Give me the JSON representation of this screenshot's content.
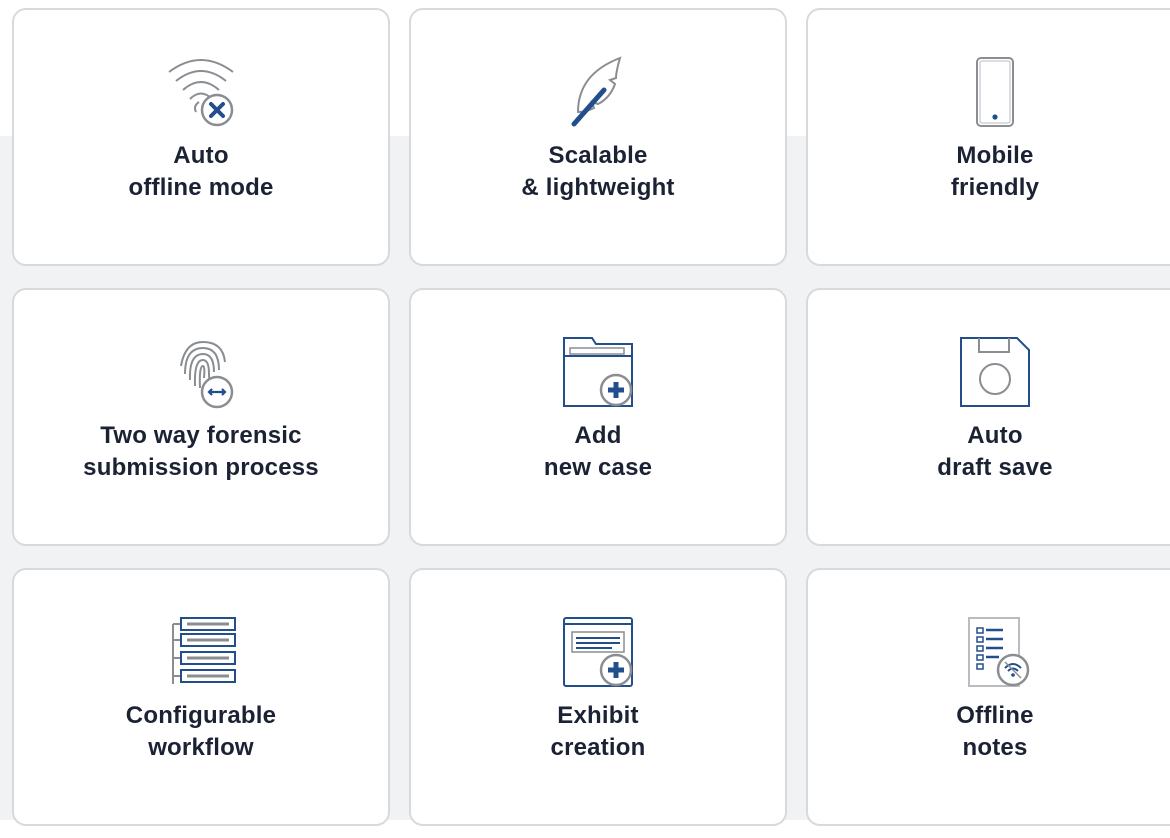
{
  "features": [
    {
      "line1": "Auto",
      "line2": "offline mode",
      "icon": "wifi-off-icon"
    },
    {
      "line1": "Scalable",
      "line2": "& lightweight",
      "icon": "feather-icon"
    },
    {
      "line1": "Mobile",
      "line2": "friendly",
      "icon": "mobile-phone-icon"
    },
    {
      "line1": "Two way forensic",
      "line2": "submission process",
      "icon": "fingerprint-icon"
    },
    {
      "line1": "Add",
      "line2": "new case",
      "icon": "folder-add-icon"
    },
    {
      "line1": "Auto",
      "line2": "draft save",
      "icon": "floppy-disk-icon"
    },
    {
      "line1": "Configurable",
      "line2": "workflow",
      "icon": "workflow-icon"
    },
    {
      "line1": "Exhibit",
      "line2": "creation",
      "icon": "exhibit-add-icon"
    },
    {
      "line1": "Offline",
      "line2": "notes",
      "icon": "offline-notes-icon"
    }
  ],
  "colors": {
    "icon_blue": "#234e8c",
    "icon_gray": "#8a8d92",
    "text": "#1b2233",
    "card_border": "#d7d9dc",
    "background_band": "#f1f2f4"
  }
}
